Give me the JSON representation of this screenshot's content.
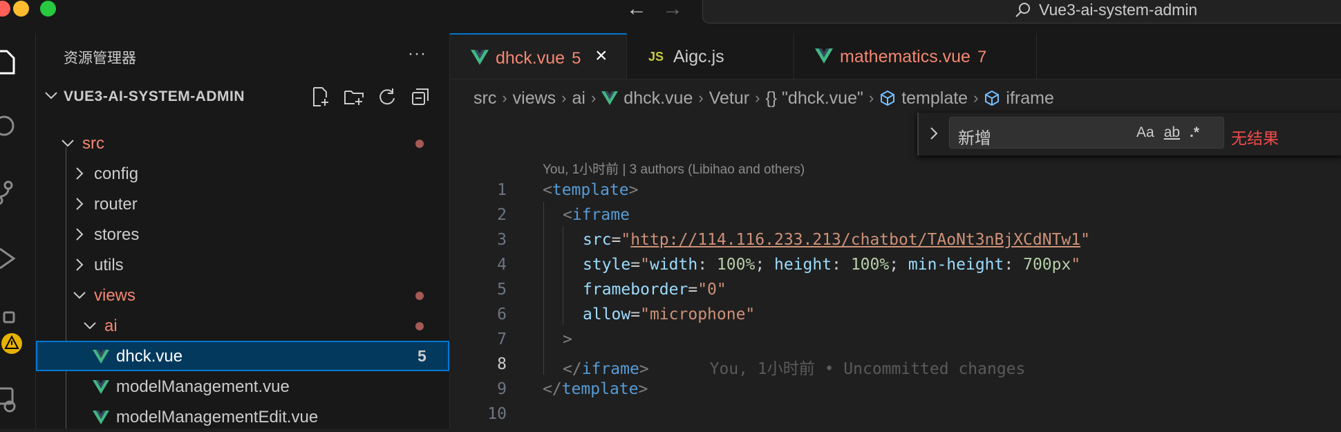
{
  "window": {
    "title": "Vue3-ai-system-admin"
  },
  "sidebar": {
    "title": "资源管理器",
    "more": "···",
    "project": "VUE3-AI-SYSTEM-ADMIN",
    "tree": [
      {
        "name": "src",
        "modified": true
      },
      {
        "name": "config"
      },
      {
        "name": "router"
      },
      {
        "name": "stores"
      },
      {
        "name": "utils"
      },
      {
        "name": "views",
        "modified": true
      },
      {
        "name": "ai",
        "modified": true
      },
      {
        "name": "dhck.vue",
        "count": "5"
      },
      {
        "name": "modelManagement.vue"
      },
      {
        "name": "modelManagementEdit.vue"
      }
    ]
  },
  "tabs": [
    {
      "label": "dhck.vue",
      "count": "5",
      "active": true
    },
    {
      "label": "Aigc.js",
      "icon": "JS"
    },
    {
      "label": "mathematics.vue",
      "count": "7"
    }
  ],
  "breadcrumb": [
    "src",
    "views",
    "ai",
    "dhck.vue",
    "Vetur",
    "{} \"dhck.vue\"",
    "template",
    "iframe"
  ],
  "find": {
    "value": "新增",
    "opt_case": "Aa",
    "opt_word": "ab",
    "opt_regex": ".*",
    "result": "无结果"
  },
  "editor": {
    "codelens": "You, 1小时前 | 3 authors (Libihao and others)",
    "line_numbers": [
      "1",
      "2",
      "3",
      "4",
      "5",
      "6",
      "7",
      "8",
      "9",
      "10"
    ],
    "current_line": 8,
    "code": {
      "l1_open": "<",
      "l1_tag": "template",
      "l1_close": ">",
      "l2_open": "<",
      "l2_tag": "iframe",
      "l3_attr": "src",
      "l3_eq": "=",
      "l3_q1": "\"",
      "l3_url": "http://114.116.233.213/chatbot/TAoNt3nBjXCdNTw1",
      "l3_q2": "\"",
      "l4_attr": "style",
      "l4_eq": "=",
      "l4_q1": "\"",
      "l4_k1": "width",
      "l4_c1": ": ",
      "l4_v1": "100%",
      "l4_s1": "; ",
      "l4_k2": "height",
      "l4_c2": ": ",
      "l4_v2": "100%",
      "l4_s2": "; ",
      "l4_k3": "min-height",
      "l4_c3": ": ",
      "l4_v3": "700px",
      "l4_q2": "\"",
      "l5_attr": "frameborder",
      "l5_eq": "=",
      "l5_val": "\"0\"",
      "l6_attr": "allow",
      "l6_eq": "=",
      "l6_val": "\"microphone\"",
      "l7_close": ">",
      "l8_open": "</",
      "l8_tag": "iframe",
      "l8_close": ">",
      "l8_blame": "You, 1小时前 • Uncommitted changes",
      "l9_open": "</",
      "l9_tag": "template",
      "l9_close": ">"
    }
  },
  "colors": {
    "accent": "#0078d4",
    "modified": "#f48771",
    "error": "#f14c4c",
    "selection": "#04395e"
  }
}
